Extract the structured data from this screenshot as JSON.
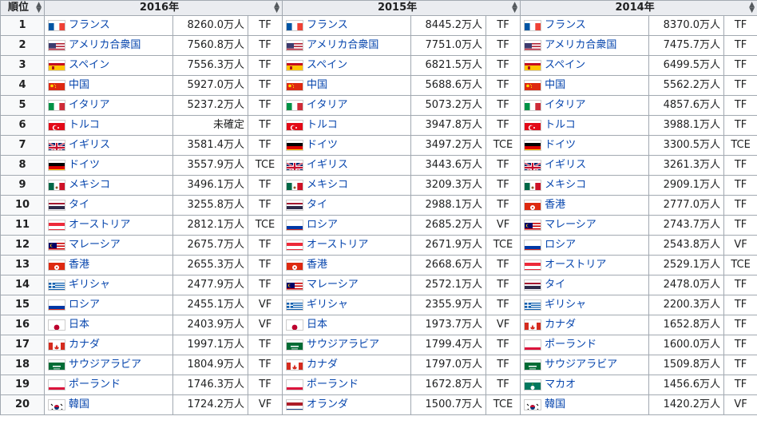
{
  "headers": {
    "rank": "順位",
    "year1": "2016年",
    "year2": "2015年",
    "year3": "2014年"
  },
  "sort_icon": "sort-arrows-icon",
  "rows": [
    {
      "rank": "1",
      "y2016": {
        "country": "フランス",
        "flag": "fr",
        "value": "8260.0万人",
        "code": "TF"
      },
      "y2015": {
        "country": "フランス",
        "flag": "fr",
        "value": "8445.2万人",
        "code": "TF"
      },
      "y2014": {
        "country": "フランス",
        "flag": "fr",
        "value": "8370.0万人",
        "code": "TF"
      }
    },
    {
      "rank": "2",
      "y2016": {
        "country": "アメリカ合衆国",
        "flag": "us",
        "value": "7560.8万人",
        "code": "TF"
      },
      "y2015": {
        "country": "アメリカ合衆国",
        "flag": "us",
        "value": "7751.0万人",
        "code": "TF"
      },
      "y2014": {
        "country": "アメリカ合衆国",
        "flag": "us",
        "value": "7475.7万人",
        "code": "TF"
      }
    },
    {
      "rank": "3",
      "y2016": {
        "country": "スペイン",
        "flag": "es",
        "value": "7556.3万人",
        "code": "TF"
      },
      "y2015": {
        "country": "スペイン",
        "flag": "es",
        "value": "6821.5万人",
        "code": "TF"
      },
      "y2014": {
        "country": "スペイン",
        "flag": "es",
        "value": "6499.5万人",
        "code": "TF"
      }
    },
    {
      "rank": "4",
      "y2016": {
        "country": "中国",
        "flag": "cn",
        "value": "5927.0万人",
        "code": "TF"
      },
      "y2015": {
        "country": "中国",
        "flag": "cn",
        "value": "5688.6万人",
        "code": "TF"
      },
      "y2014": {
        "country": "中国",
        "flag": "cn",
        "value": "5562.2万人",
        "code": "TF"
      }
    },
    {
      "rank": "5",
      "y2016": {
        "country": "イタリア",
        "flag": "it",
        "value": "5237.2万人",
        "code": "TF"
      },
      "y2015": {
        "country": "イタリア",
        "flag": "it",
        "value": "5073.2万人",
        "code": "TF"
      },
      "y2014": {
        "country": "イタリア",
        "flag": "it",
        "value": "4857.6万人",
        "code": "TF"
      }
    },
    {
      "rank": "6",
      "y2016": {
        "country": "トルコ",
        "flag": "tr",
        "value": "未確定",
        "code": "TF"
      },
      "y2015": {
        "country": "トルコ",
        "flag": "tr",
        "value": "3947.8万人",
        "code": "TF"
      },
      "y2014": {
        "country": "トルコ",
        "flag": "tr",
        "value": "3988.1万人",
        "code": "TF"
      }
    },
    {
      "rank": "7",
      "y2016": {
        "country": "イギリス",
        "flag": "gb",
        "value": "3581.4万人",
        "code": "TF"
      },
      "y2015": {
        "country": "ドイツ",
        "flag": "de",
        "value": "3497.2万人",
        "code": "TCE"
      },
      "y2014": {
        "country": "ドイツ",
        "flag": "de",
        "value": "3300.5万人",
        "code": "TCE"
      }
    },
    {
      "rank": "8",
      "y2016": {
        "country": "ドイツ",
        "flag": "de",
        "value": "3557.9万人",
        "code": "TCE"
      },
      "y2015": {
        "country": "イギリス",
        "flag": "gb",
        "value": "3443.6万人",
        "code": "TF"
      },
      "y2014": {
        "country": "イギリス",
        "flag": "gb",
        "value": "3261.3万人",
        "code": "TF"
      }
    },
    {
      "rank": "9",
      "y2016": {
        "country": "メキシコ",
        "flag": "mx",
        "value": "3496.1万人",
        "code": "TF"
      },
      "y2015": {
        "country": "メキシコ",
        "flag": "mx",
        "value": "3209.3万人",
        "code": "TF"
      },
      "y2014": {
        "country": "メキシコ",
        "flag": "mx",
        "value": "2909.1万人",
        "code": "TF"
      }
    },
    {
      "rank": "10",
      "y2016": {
        "country": "タイ",
        "flag": "th",
        "value": "3255.8万人",
        "code": "TF"
      },
      "y2015": {
        "country": "タイ",
        "flag": "th",
        "value": "2988.1万人",
        "code": "TF"
      },
      "y2014": {
        "country": "香港",
        "flag": "hk",
        "value": "2777.0万人",
        "code": "TF"
      }
    },
    {
      "rank": "11",
      "y2016": {
        "country": "オーストリア",
        "flag": "at",
        "value": "2812.1万人",
        "code": "TCE"
      },
      "y2015": {
        "country": "ロシア",
        "flag": "ru",
        "value": "2685.2万人",
        "code": "VF"
      },
      "y2014": {
        "country": "マレーシア",
        "flag": "my",
        "value": "2743.7万人",
        "code": "TF"
      }
    },
    {
      "rank": "12",
      "y2016": {
        "country": "マレーシア",
        "flag": "my",
        "value": "2675.7万人",
        "code": "TF"
      },
      "y2015": {
        "country": "オーストリア",
        "flag": "at",
        "value": "2671.9万人",
        "code": "TCE"
      },
      "y2014": {
        "country": "ロシア",
        "flag": "ru",
        "value": "2543.8万人",
        "code": "VF"
      }
    },
    {
      "rank": "13",
      "y2016": {
        "country": "香港",
        "flag": "hk",
        "value": "2655.3万人",
        "code": "TF"
      },
      "y2015": {
        "country": "香港",
        "flag": "hk",
        "value": "2668.6万人",
        "code": "TF"
      },
      "y2014": {
        "country": "オーストリア",
        "flag": "at",
        "value": "2529.1万人",
        "code": "TCE"
      }
    },
    {
      "rank": "14",
      "y2016": {
        "country": "ギリシャ",
        "flag": "gr",
        "value": "2477.9万人",
        "code": "TF"
      },
      "y2015": {
        "country": "マレーシア",
        "flag": "my",
        "value": "2572.1万人",
        "code": "TF"
      },
      "y2014": {
        "country": "タイ",
        "flag": "th",
        "value": "2478.0万人",
        "code": "TF"
      }
    },
    {
      "rank": "15",
      "y2016": {
        "country": "ロシア",
        "flag": "ru",
        "value": "2455.1万人",
        "code": "VF"
      },
      "y2015": {
        "country": "ギリシャ",
        "flag": "gr",
        "value": "2355.9万人",
        "code": "TF"
      },
      "y2014": {
        "country": "ギリシャ",
        "flag": "gr",
        "value": "2200.3万人",
        "code": "TF"
      }
    },
    {
      "rank": "16",
      "y2016": {
        "country": "日本",
        "flag": "jp",
        "value": "2403.9万人",
        "code": "VF"
      },
      "y2015": {
        "country": "日本",
        "flag": "jp",
        "value": "1973.7万人",
        "code": "VF"
      },
      "y2014": {
        "country": "カナダ",
        "flag": "ca",
        "value": "1652.8万人",
        "code": "TF"
      }
    },
    {
      "rank": "17",
      "y2016": {
        "country": "カナダ",
        "flag": "ca",
        "value": "1997.1万人",
        "code": "TF"
      },
      "y2015": {
        "country": "サウジアラビア",
        "flag": "sa",
        "value": "1799.4万人",
        "code": "TF"
      },
      "y2014": {
        "country": "ポーランド",
        "flag": "pl",
        "value": "1600.0万人",
        "code": "TF"
      }
    },
    {
      "rank": "18",
      "y2016": {
        "country": "サウジアラビア",
        "flag": "sa",
        "value": "1804.9万人",
        "code": "TF"
      },
      "y2015": {
        "country": "カナダ",
        "flag": "ca",
        "value": "1797.0万人",
        "code": "TF"
      },
      "y2014": {
        "country": "サウジアラビア",
        "flag": "sa",
        "value": "1509.8万人",
        "code": "TF"
      }
    },
    {
      "rank": "19",
      "y2016": {
        "country": "ポーランド",
        "flag": "pl",
        "value": "1746.3万人",
        "code": "TF"
      },
      "y2015": {
        "country": "ポーランド",
        "flag": "pl",
        "value": "1672.8万人",
        "code": "TF"
      },
      "y2014": {
        "country": "マカオ",
        "flag": "mo",
        "value": "1456.6万人",
        "code": "TF"
      }
    },
    {
      "rank": "20",
      "y2016": {
        "country": "韓国",
        "flag": "kr",
        "value": "1724.2万人",
        "code": "VF"
      },
      "y2015": {
        "country": "オランダ",
        "flag": "nl",
        "value": "1500.7万人",
        "code": "TCE"
      },
      "y2014": {
        "country": "韓国",
        "flag": "kr",
        "value": "1420.2万人",
        "code": "VF"
      }
    }
  ]
}
